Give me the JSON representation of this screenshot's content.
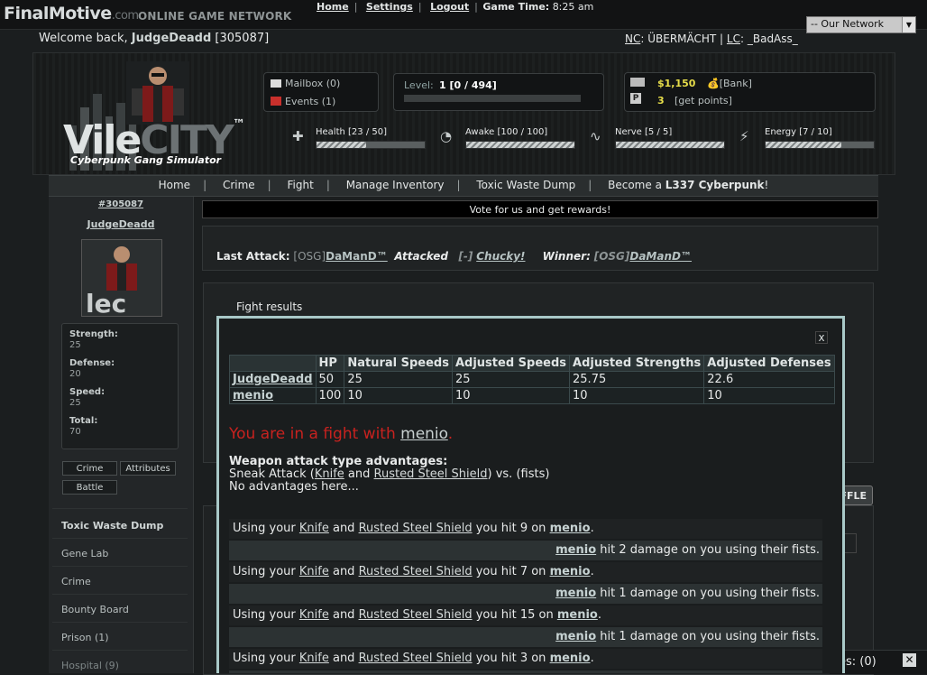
{
  "site": {
    "brand": "FinalMotive",
    "brand_suffix": ".com",
    "network_tag": "ONLINE GAME NETWORK"
  },
  "topnav": {
    "home": "Home",
    "settings": "Settings",
    "logout": "Logout",
    "game_time_label": "Game Time:",
    "game_time_value": "8:25 am"
  },
  "network_select": {
    "selected": "-- Our Network"
  },
  "welcome": {
    "prefix": "Welcome back, ",
    "username": "JudgeDeadd",
    "id": "[305087]"
  },
  "gang": {
    "nc_label": "NC",
    "nc_value": ": ÜBERMÄCHT | ",
    "lc_label": "LC",
    "lc_value": ": _BadAss_"
  },
  "header": {
    "logo_main": "Vile",
    "logo_accent": "CITY",
    "logo_tm": "™",
    "logo_sub": "Cyberpunk Gang Simulator",
    "mailbox": "Mailbox (0)",
    "events": "Events (1)",
    "level_label": "Level:",
    "level_value": "1 [0 / 494]",
    "money": "$1,150",
    "bank": "[Bank]",
    "points": "3",
    "get_points": "[get points]",
    "stats": [
      {
        "label": "Health [23 / 50]",
        "fill": 0.46
      },
      {
        "label": "Awake [100 / 100]",
        "fill": 1.0
      },
      {
        "label": "Nerve [5 / 5]",
        "fill": 1.0
      },
      {
        "label": "Energy [7 / 10]",
        "fill": 0.7
      }
    ]
  },
  "mainnav": {
    "items": [
      "Home",
      "Crime",
      "Fight",
      "Manage Inventory",
      "Toxic Waste Dump"
    ],
    "become_prefix": "Become a ",
    "become_bold": "L337 Cyberpunk",
    "become_suffix": "!"
  },
  "left": {
    "uid": "#305087",
    "uname": "JudgeDeadd",
    "stats": [
      {
        "label": "Strength:",
        "value": "25"
      },
      {
        "label": "Defense:",
        "value": "20"
      },
      {
        "label": "Speed:",
        "value": "25"
      },
      {
        "label": "Total:",
        "value": "70"
      }
    ],
    "btn_crime": "Crime",
    "btn_attributes": "Attributes",
    "btn_battle": "Battle",
    "side_items": [
      "Toxic Waste Dump",
      "Gene Lab",
      "Crime",
      "Bounty Board",
      "Prison (1)",
      "Hospital (9)"
    ]
  },
  "content": {
    "vote": "Vote for us and get rewards!",
    "last_attack_label": "Last Attack:",
    "la_tag1": "[OSG]",
    "la_name1": "DaManD™",
    "la_attacked": "Attacked",
    "la_tag2": "[-]",
    "la_name2": "Chucky!",
    "la_winner": "Winner:",
    "la_tag3": "[OSG]",
    "la_name3": "DaManD™",
    "fight_results": "Fight results",
    "shuffle": "FFLE",
    "bottom_text": "es: (0)"
  },
  "modal": {
    "close": "x",
    "columns": [
      "",
      "HP",
      "Natural Speeds",
      "Adjusted Speeds",
      "Adjusted Strengths",
      "Adjusted Defenses"
    ],
    "rows": [
      [
        "JudgeDeadd",
        "50",
        "25",
        "25",
        "25.75",
        "22.6"
      ],
      [
        "menio",
        "100",
        "10",
        "10",
        "10",
        "10"
      ]
    ],
    "infight_prefix": "You are in a fight with ",
    "infight_name": "menio",
    "infight_suffix": ".",
    "adv_heading": "Weapon attack type advantages:",
    "adv_line1_a": "Sneak Attack (",
    "adv_weapon1": "Knife",
    "adv_and": " and ",
    "adv_weapon2": "Rusted Steel Shield",
    "adv_line1_b": ") vs. (fists)",
    "adv_line2": "No advantages here...",
    "log_me": [
      {
        "hit": "9"
      },
      {
        "hit": "7"
      },
      {
        "hit": "15"
      },
      {
        "hit": "3"
      }
    ],
    "log_them": [
      {
        "dmg": "2"
      },
      {
        "dmg": "1"
      },
      {
        "dmg": "1"
      }
    ],
    "log_using": "Using your ",
    "log_knife": "Knife",
    "log_and": " and ",
    "log_shield": "Rusted Steel Shield",
    "log_youhit": " you hit ",
    "log_on": " on ",
    "log_opp": "menio",
    "log_hit_prefix": " hit ",
    "log_hit_suffix": " damage on you using their fists."
  }
}
